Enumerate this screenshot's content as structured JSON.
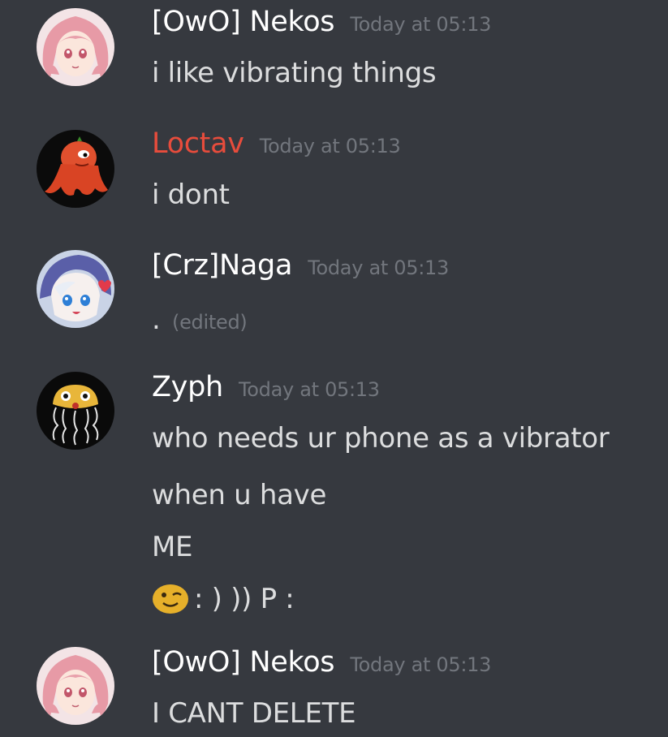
{
  "colors": {
    "background": "#36393f",
    "username_default": "#ffffff",
    "username_red": "#e74c3c",
    "timestamp": "#72767d",
    "message_text": "#dcddde"
  },
  "messages": [
    {
      "avatar": "anime-pink-hair-avatar",
      "username": "[OwO] Nekos",
      "username_color": "#ffffff",
      "timestamp": "Today at 05:13",
      "lines": [
        "i like vibrating things"
      ]
    },
    {
      "avatar": "orange-octopus-avatar",
      "username": "Loctav",
      "username_color": "#e74c3c",
      "timestamp": "Today at 05:13",
      "lines": [
        "i dont"
      ]
    },
    {
      "avatar": "anime-blue-hood-avatar",
      "username": "[Crz]Naga",
      "username_color": "#ffffff",
      "timestamp": "Today at 05:13",
      "lines": [
        "."
      ],
      "edited_label": "(edited)"
    },
    {
      "avatar": "jellyfish-avatar",
      "username": "Zyph",
      "username_color": "#ffffff",
      "timestamp": "Today at 05:13",
      "lines": [
        "who needs ur phone as a vibrator",
        "when u have",
        "ME",
        ": ) )) P  :"
      ],
      "emoji": "winking-face-emoji"
    },
    {
      "avatar": "anime-pink-hair-avatar",
      "username": "[OwO] Nekos",
      "username_color": "#ffffff",
      "timestamp": "Today at 05:13",
      "lines": [
        "I CANT DELETE"
      ]
    }
  ]
}
